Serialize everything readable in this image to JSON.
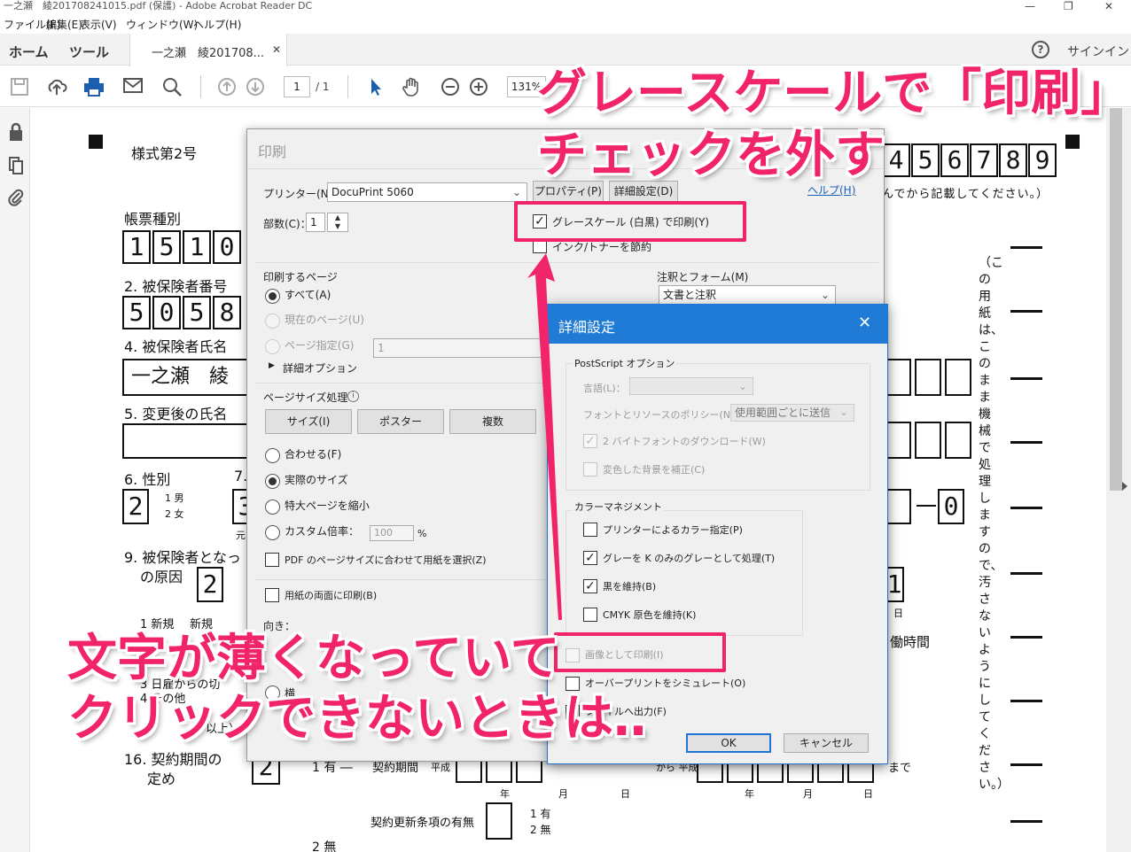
{
  "window": {
    "title": "一之瀬　綾201708241015.pdf (保護) - Adobe Acrobat Reader DC",
    "minimize": "—",
    "maximize": "❐",
    "close": "✕"
  },
  "menu": [
    "ファイル(F)",
    "編集(E)",
    "表示(V)",
    "ウィンドウ(W)",
    "ヘルプ(H)"
  ],
  "tabs": {
    "home": "ホーム",
    "tools": "ツール",
    "document": "一之瀬　綾201708...",
    "close": "✕",
    "help": "?",
    "signin": "サインイン"
  },
  "toolbar": {
    "page_current": "1",
    "page_total": "/ 1",
    "zoom": "131%"
  },
  "document": {
    "form_no": "様式第2号",
    "digits_top": [
      "4",
      "5",
      "6",
      "7",
      "8",
      "9"
    ],
    "notice": "んでから記載してください。）",
    "sec_type": "帳票種別",
    "type_digits": [
      "1",
      "5",
      "1",
      "0"
    ],
    "sec_insured_no": "2. 被保険者番号",
    "insured_digits": [
      "5",
      "0",
      "5",
      "8"
    ],
    "sec_name": "4. 被保険者氏名",
    "name_value": "一之瀬　綾",
    "sec_new_name": "5. 変更後の氏名",
    "sec_sex": "6. 性別",
    "sec_7": "7.",
    "sex_value": "2",
    "sex_opt_male": "1 男",
    "sex_opt_female": "2 女",
    "sec_7_value": "3",
    "sec_7_sub": "元",
    "sec_cause": "9. 被保険者となっ",
    "sec_cause2": "の原因",
    "cause_value": "2",
    "cause_opt1": "1 新規",
    "cause_opt1b": "新規",
    "cause_opt3": "3 日雇からの切",
    "cause_opt4": "4 その他",
    "cause_opt_end": "以上）",
    "sec_contract": "16. 契約期間の",
    "sec_contract2": "定め",
    "contract_value": "2",
    "contract_opt1": "1 有 ―",
    "contract_opt2": "2 無",
    "contract_period": "契約期間",
    "heisei": "平成",
    "kara_heisei": "から 平成",
    "made": "まで",
    "nen": "年",
    "tsuki": "月",
    "hi": "日",
    "renewal": "契約更新条項の有無",
    "renewal_opt1": "1 有",
    "renewal_opt2": "2 無",
    "work_hours": "働時間",
    "right_digit": "0",
    "right_digit2": "1",
    "vertical_text": "（この用紙は、このまま機械で処理しますので、汚さないようにしてください。）"
  },
  "print_dialog": {
    "title": "印刷",
    "close": "✕",
    "printer_label": "プリンター(N)：",
    "printer_value": "DocuPrint 5060",
    "properties_button": "プロパティ(P)",
    "advanced_button": "詳細設定(D)",
    "help_link": "ヘルプ(H)",
    "copies_label": "部数(C)：",
    "copies_value": "1",
    "grayscale_label": "グレースケール (白黒) で印刷(Y)",
    "ink_label": "インク/トナーを節約",
    "pages_group": "印刷するページ",
    "all_label": "すべて(A)",
    "current_label": "現在のページ(U)",
    "range_label": "ページ指定(G)",
    "range_value": "1",
    "more_options": "詳細オプション",
    "comments_group": "注釈とフォーム(M)",
    "comments_value": "文書と注釈",
    "sizing_group": "ページサイズ処理",
    "size_button": "サイズ(I)",
    "poster_button": "ポスター",
    "multiple_button": "複数",
    "fit_label": "合わせる(F)",
    "actual_label": "実際のサイズ",
    "shrink_label": "特大ページを縮小",
    "custom_label": "カスタム倍率：",
    "custom_value": "100",
    "percent": "%",
    "pdf_paper_label": "PDF のページサイズに合わせて用紙を選択(Z)",
    "duplex_label": "用紙の両面に印刷(B)",
    "orientation_label": "向き：",
    "landscape_label": "横"
  },
  "advanced_dialog": {
    "title": "詳細設定",
    "close": "✕",
    "postscript_group": "PostScript オプション",
    "language_label": "言語(L)：",
    "font_policy_label": "フォントとリソースのポリシー(N)：",
    "font_policy_value": "使用範囲ごとに送信",
    "download_2byte": "2 バイトフォントのダウンロード(W)",
    "discolored_bg": "変色した背景を補正(C)",
    "color_group": "カラーマネジメント",
    "printer_color": "プリンターによるカラー指定(P)",
    "gray_k": "グレーを K のみのグレーとして処理(T)",
    "keep_black": "黒を維持(B)",
    "keep_cmyk": "CMYK 原色を維持(K)",
    "print_as_image": "画像として印刷(I)",
    "simulate_overprint": "オーバープリントをシミュレート(O)",
    "output_to_file": "ファイルへ出力(F)",
    "ok_button": "OK",
    "cancel_button": "キャンセル"
  },
  "annotations": {
    "headline1": "グレースケールで「印刷」",
    "headline2": "チェックを外す",
    "bottom1": "文字が薄くなっていて",
    "bottom2": "クリックできないときは‥",
    "color": "#f0236b"
  }
}
